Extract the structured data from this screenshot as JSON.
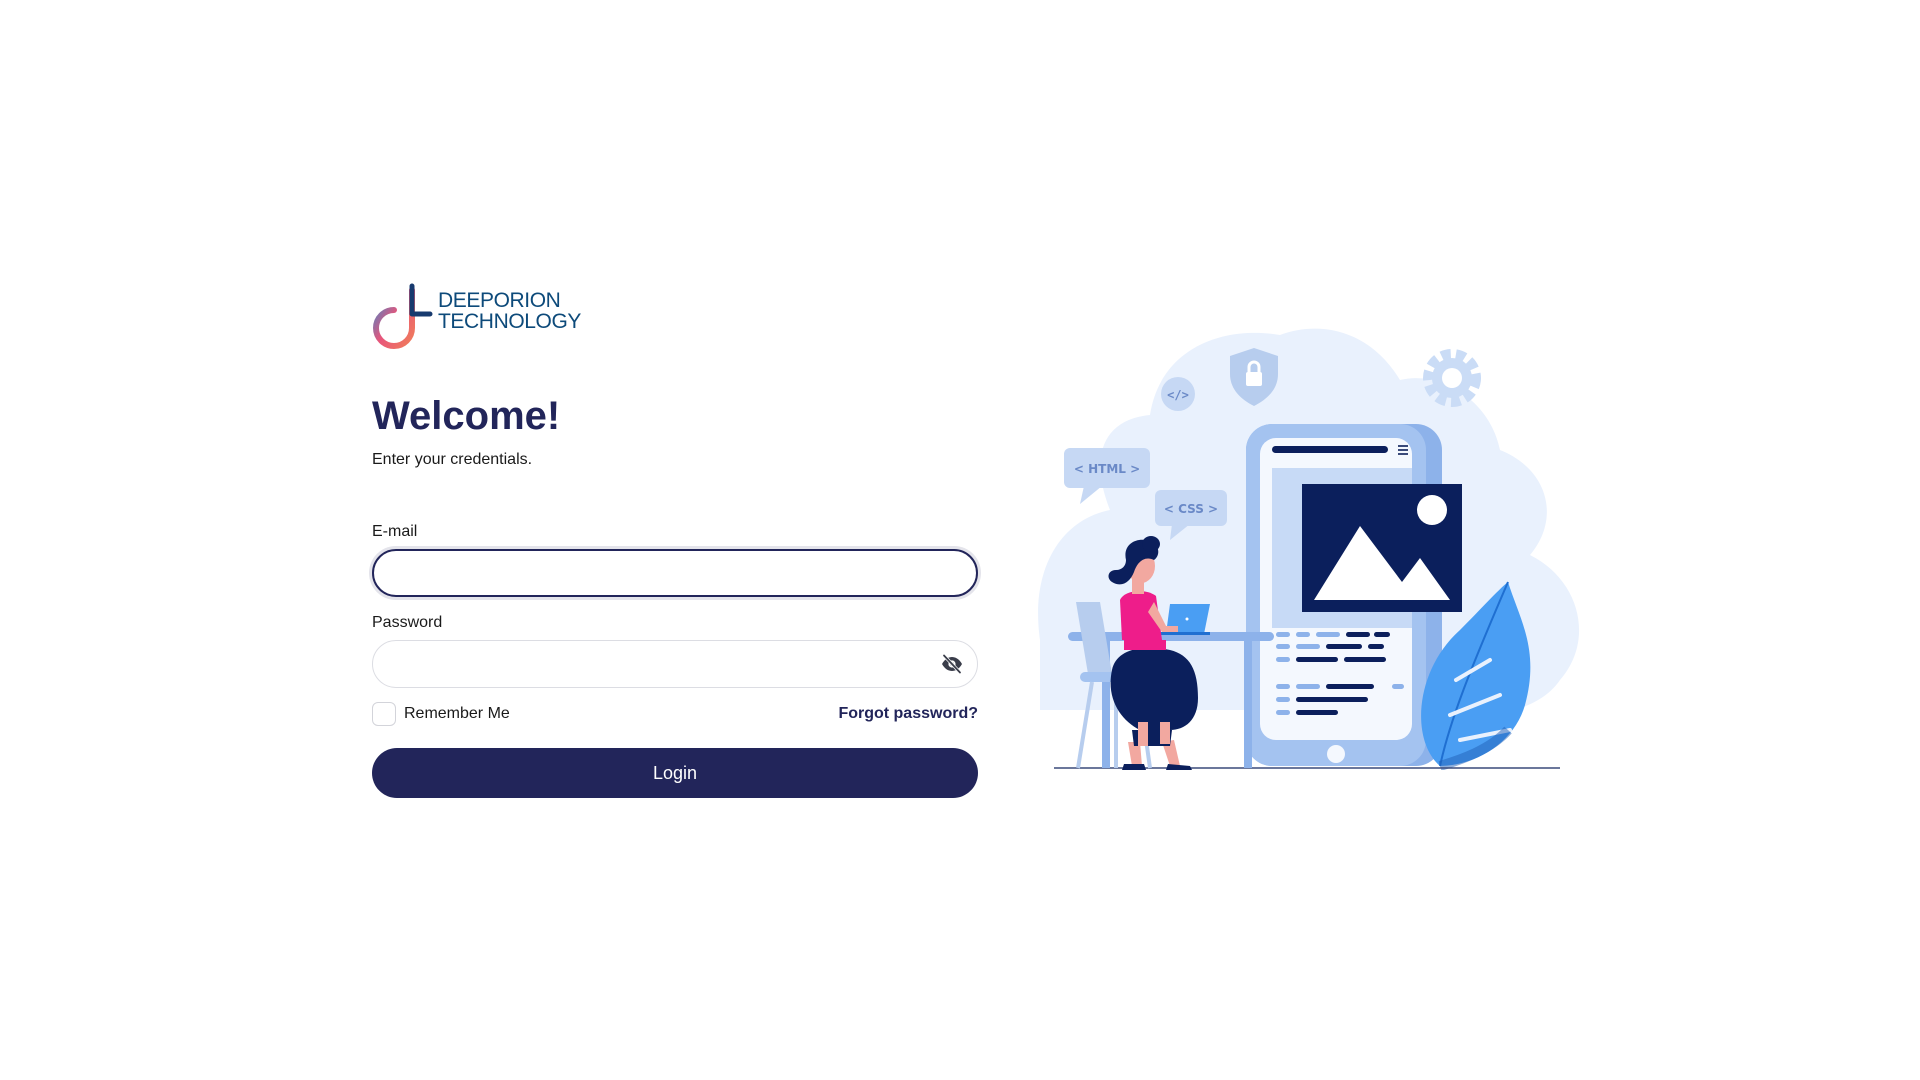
{
  "brand": {
    "line1": "DEEPORION",
    "line2": "TECHNOLOGY"
  },
  "welcome": {
    "title": "Welcome!",
    "subtitle": "Enter your credentials."
  },
  "form": {
    "email_label": "E-mail",
    "email_value": "",
    "password_label": "Password",
    "password_value": "",
    "remember_label": "Remember Me",
    "remember_checked": false,
    "forgot_label": "Forgot password?",
    "login_label": "Login"
  },
  "illustration": {
    "html_tag": "< HTML >",
    "css_tag": "< CSS >",
    "code_tag": "</>"
  },
  "colors": {
    "primary": "#22255a",
    "brand_blue": "#0d4a7a",
    "accent_pink": "#ee1d8a",
    "light_blue": "#e9f1fd",
    "mid_blue": "#8db2ea",
    "navy": "#0b1f5c"
  }
}
